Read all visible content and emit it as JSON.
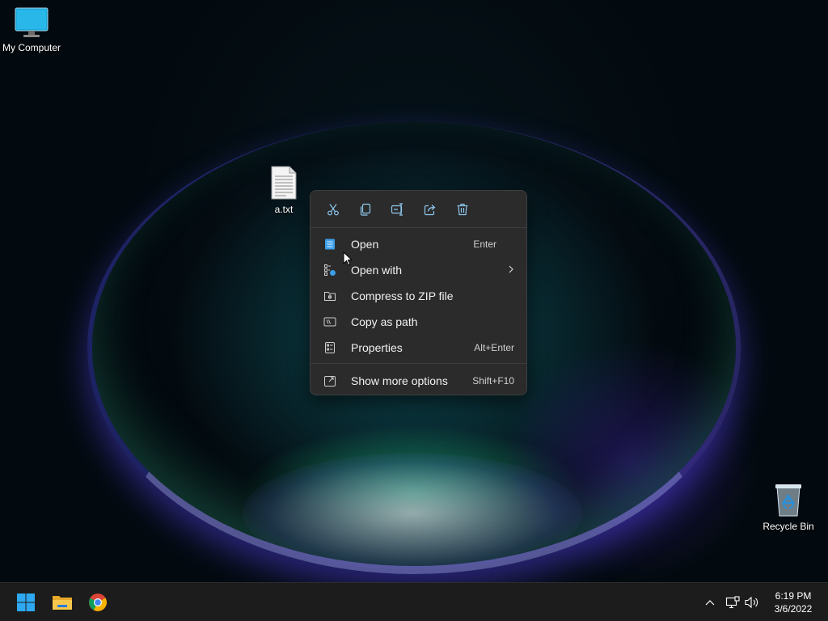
{
  "desktop": {
    "icons": [
      {
        "label": "My Computer",
        "icon": "monitor-icon"
      },
      {
        "label": "a.txt",
        "icon": "text-file-icon"
      },
      {
        "label": "Recycle Bin",
        "icon": "recycle-bin-icon"
      }
    ]
  },
  "context_menu": {
    "toolbar": [
      {
        "name": "Cut",
        "icon": "scissors-icon"
      },
      {
        "name": "Copy",
        "icon": "copy-icon"
      },
      {
        "name": "Rename",
        "icon": "rename-icon"
      },
      {
        "name": "Share",
        "icon": "share-icon"
      },
      {
        "name": "Delete",
        "icon": "trash-icon"
      }
    ],
    "items": [
      {
        "label": "Open",
        "shortcut": "Enter",
        "icon": "notepad-icon"
      },
      {
        "label": "Open with",
        "shortcut": "",
        "icon": "open-with-icon",
        "submenu": true
      },
      {
        "label": "Compress to ZIP file",
        "shortcut": "",
        "icon": "zip-icon"
      },
      {
        "label": "Copy as path",
        "shortcut": "",
        "icon": "copy-path-icon"
      },
      {
        "label": "Properties",
        "shortcut": "Alt+Enter",
        "icon": "properties-icon"
      },
      {
        "label": "Show more options",
        "shortcut": "Shift+F10",
        "icon": "more-options-icon"
      }
    ]
  },
  "taskbar": {
    "apps": [
      {
        "name": "Start",
        "icon": "windows-start-icon"
      },
      {
        "name": "File Explorer",
        "icon": "folder-icon"
      },
      {
        "name": "Google Chrome",
        "icon": "chrome-icon"
      }
    ],
    "tray": [
      "chevron-up-icon",
      "network-icon",
      "volume-icon"
    ],
    "time": "6:19 PM",
    "date": "3/6/2022"
  },
  "colors": {
    "menu_bg": "#2b2b2b",
    "accent": "#4cc2ff",
    "taskbar_bg": "#1c1c1c"
  }
}
